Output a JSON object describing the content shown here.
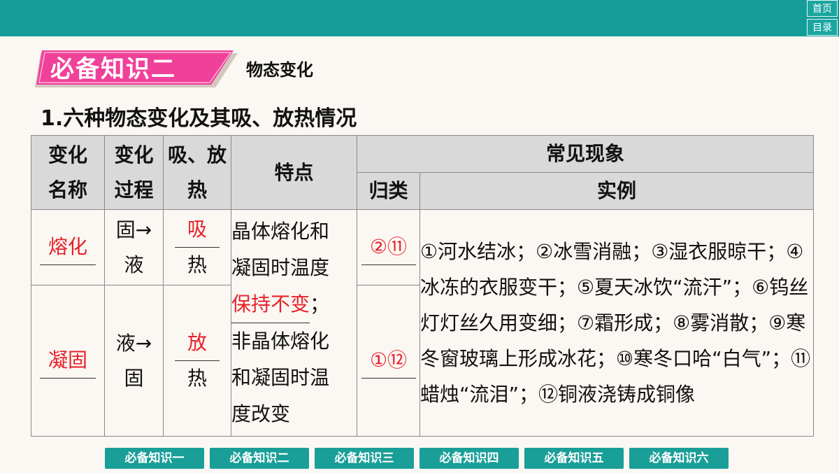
{
  "nav": {
    "home": "首页",
    "toc": "目录"
  },
  "banner": {
    "title": "必备知识二",
    "subtitle": "物态变化"
  },
  "heading": "1.六种物态变化及其吸、放热情况",
  "table": {
    "headers": {
      "name": [
        "变化",
        "名称"
      ],
      "process": [
        "变化",
        "过程"
      ],
      "heat": [
        "吸、放",
        "热"
      ],
      "feature": "特点",
      "phenomena": "常见现象",
      "category": "归类",
      "examples": "实例"
    },
    "rows": [
      {
        "name": "熔化",
        "process": [
          "固→",
          "液"
        ],
        "heat_answer": "吸",
        "heat_suffix": "热",
        "category": "②⑪"
      },
      {
        "name": "凝固",
        "process": [
          "液→",
          "固"
        ],
        "heat_answer": "放",
        "heat_suffix": "热",
        "category": "①⑫"
      }
    ],
    "feature": {
      "line1": "晶体熔化和",
      "line2": "凝固时温度",
      "answer": "保持不变",
      "punct": "；",
      "line4": "非晶体熔化",
      "line5": "和凝固时温",
      "line6": "度改变"
    },
    "examples": "①河水结冰；②冰雪消融；③湿衣服晾干；④冰冻的衣服变干；⑤夏天冰饮“流汗”；⑥钨丝灯灯丝久用变细；⑦霜形成；⑧雾消散；⑨寒冬窗玻璃上形成冰花；⑩寒冬口哈“白气”；⑪蜡烛“流泪”；⑫铜液浇铸成铜像"
  },
  "bottom_nav": [
    "必备知识一",
    "必备知识二",
    "必备知识三",
    "必备知识四",
    "必备知识五",
    "必备知识六"
  ],
  "colors": {
    "teal": "#149d98",
    "pink": "#f0419a",
    "answer_red": "#e8202a"
  }
}
